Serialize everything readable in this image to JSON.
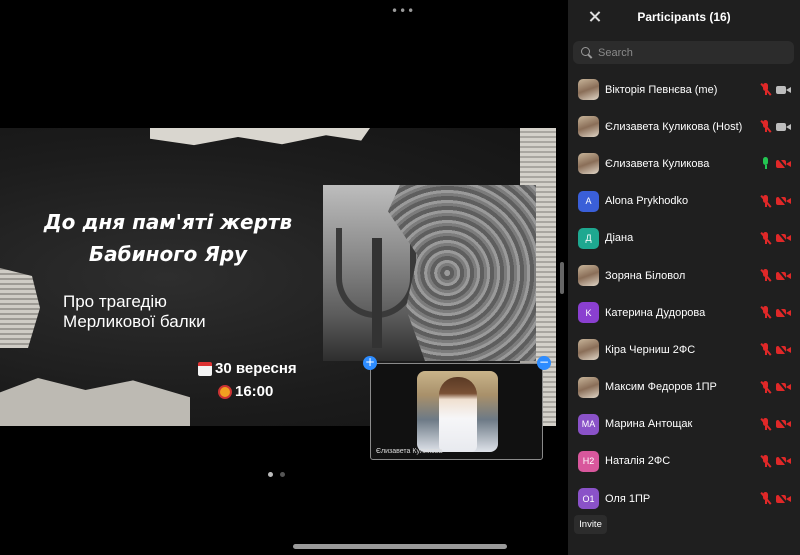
{
  "slide": {
    "title_line1": "До дня пам'яті жертв",
    "title_line2": "Бабиного Яру",
    "subtitle_line1": "Про трагедію",
    "subtitle_line2": "Мерликової балки",
    "date": "30 вересня",
    "time": "16:00"
  },
  "video": {
    "name": "Єлизавета Куликова"
  },
  "pager": {
    "pages": 2,
    "active": 0
  },
  "panel": {
    "title": "Participants (16)",
    "search_placeholder": "Search",
    "invite_label": "Invite"
  },
  "participants": [
    {
      "name": "Вікторія Певнєва (me)",
      "avatar_text": "",
      "avatar_color": "photo",
      "mic": "muted",
      "video": "on"
    },
    {
      "name": "Єлизавета Куликова (Host)",
      "avatar_text": "",
      "avatar_color": "photo",
      "mic": "muted",
      "video": "on"
    },
    {
      "name": "Єлизавета Куликова",
      "avatar_text": "",
      "avatar_color": "photo",
      "mic": "on",
      "video": "off"
    },
    {
      "name": "Alona Prykhodko",
      "avatar_text": "A",
      "avatar_color": "#3a5fd8",
      "mic": "muted",
      "video": "off"
    },
    {
      "name": "Діана",
      "avatar_text": "Д",
      "avatar_color": "#1ea890",
      "mic": "muted",
      "video": "off"
    },
    {
      "name": "Зоряна Біловол",
      "avatar_text": "",
      "avatar_color": "photo",
      "mic": "muted",
      "video": "off"
    },
    {
      "name": "Катерина Дудорова",
      "avatar_text": "K",
      "avatar_color": "#8a3fd0",
      "mic": "muted",
      "video": "off"
    },
    {
      "name": "Кіра Черниш 2ФС",
      "avatar_text": "",
      "avatar_color": "photo",
      "mic": "muted",
      "video": "off"
    },
    {
      "name": "Максим Федоров 1ПР",
      "avatar_text": "",
      "avatar_color": "photo",
      "mic": "muted",
      "video": "off"
    },
    {
      "name": "Марина Антощак",
      "avatar_text": "MA",
      "avatar_color": "#8a52c8",
      "mic": "muted",
      "video": "off"
    },
    {
      "name": "Наталія 2ФС",
      "avatar_text": "H2",
      "avatar_color": "#d8579c",
      "mic": "muted",
      "video": "off"
    },
    {
      "name": "Оля 1ПР",
      "avatar_text": "O1",
      "avatar_color": "#8a52c8",
      "mic": "muted",
      "video": "off"
    }
  ],
  "colors": {
    "muted_red": "#e02828",
    "mic_green": "#23c552",
    "pin_blue": "#2d8cff",
    "panel_bg": "#1f1f1f"
  }
}
